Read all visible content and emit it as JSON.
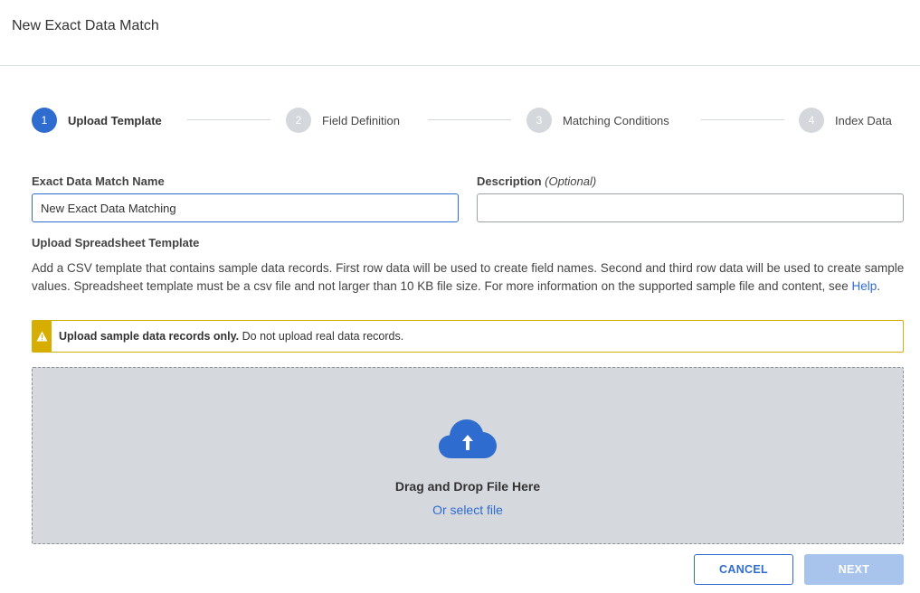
{
  "header": {
    "title": "New Exact Data Match"
  },
  "stepper": {
    "steps": [
      {
        "number": "1",
        "label": "Upload Template",
        "state": "active"
      },
      {
        "number": "2",
        "label": "Field Definition",
        "state": "inactive"
      },
      {
        "number": "3",
        "label": "Matching Conditions",
        "state": "inactive"
      },
      {
        "number": "4",
        "label": "Index Data",
        "state": "inactive"
      }
    ]
  },
  "form": {
    "name_label": "Exact Data Match Name",
    "name_value": "New Exact Data Matching",
    "description_label": "Description",
    "description_optional": "(Optional)",
    "description_value": ""
  },
  "upload": {
    "section_title": "Upload Spreadsheet Template",
    "description": "Add a CSV template that contains sample data records. First row data will be used to create field names. Second and third row data will be used to create sample values. Spreadsheet template must be a csv file and not larger than 10 KB file size. For more information on the supported sample file and content, see ",
    "help_link": "Help",
    "description_end": "."
  },
  "warning": {
    "bold_text": "Upload sample data records only.",
    "text": " Do not upload real data records.",
    "icon": "warning-triangle-icon"
  },
  "dropzone": {
    "icon": "cloud-upload-icon",
    "title": "Drag and Drop File Here",
    "select_link": "Or select file"
  },
  "buttons": {
    "cancel": "CANCEL",
    "next": "NEXT"
  },
  "colors": {
    "accent": "#2f6ccf",
    "warning": "#d6ad00",
    "next_disabled": "#a9c4ec",
    "dropzone_bg": "#d5d8dd"
  }
}
